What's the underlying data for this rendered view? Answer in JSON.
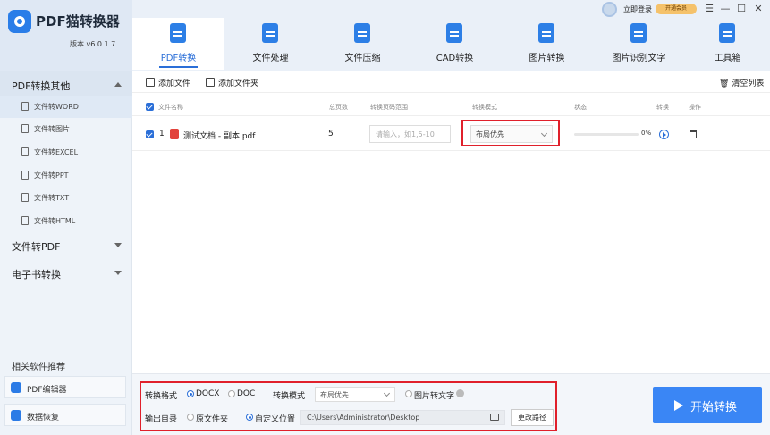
{
  "app": {
    "title": "PDF猫转换器",
    "version": "版本 v6.0.1.7"
  },
  "header": {
    "login": "立即登录",
    "vip": "开通会员",
    "menu_icon": "menu-icon",
    "minimize_icon": "minimize-icon",
    "maximize_icon": "maximize-icon",
    "close_icon": "close-icon"
  },
  "nav": {
    "tabs": [
      {
        "label": "PDF转换",
        "icon": "pdf-convert-icon",
        "active": true
      },
      {
        "label": "文件处理",
        "icon": "file-process-icon"
      },
      {
        "label": "文件压缩",
        "icon": "compress-icon"
      },
      {
        "label": "CAD转换",
        "icon": "cad-icon"
      },
      {
        "label": "图片转换",
        "icon": "image-convert-icon"
      },
      {
        "label": "图片识别文字",
        "icon": "ocr-icon"
      },
      {
        "label": "工具箱",
        "icon": "toolbox-icon"
      }
    ]
  },
  "sidebar": {
    "group_pdf": "PDF转换其他",
    "items": [
      {
        "label": "文件转WORD"
      },
      {
        "label": "文件转图片"
      },
      {
        "label": "文件转EXCEL"
      },
      {
        "label": "文件转PPT"
      },
      {
        "label": "文件转TXT"
      },
      {
        "label": "文件转HTML"
      }
    ],
    "group_to_pdf": "文件转PDF",
    "group_ebook": "电子书转换",
    "recommend_title": "相关软件推荐",
    "recommend": [
      {
        "label": "PDF编辑器"
      },
      {
        "label": "数据恢复"
      }
    ]
  },
  "toolbar": {
    "add_file": "添加文件",
    "add_folder": "添加文件夹",
    "clear_list": "清空列表"
  },
  "table": {
    "headers": {
      "name": "文件名称",
      "pages": "总页数",
      "range": "转换页码范围",
      "mode": "转换模式",
      "status": "状态",
      "convert": "转换",
      "action": "操作"
    },
    "rows": [
      {
        "index": "1",
        "name": "测试文档 - 副本.pdf",
        "pages": "5",
        "range_placeholder": "请输入，如1,5-10",
        "mode": "布局优先",
        "progress": 0,
        "progress_text": "0%"
      }
    ]
  },
  "bottom": {
    "format_label": "转换格式",
    "format_docx": "DOCX",
    "format_doc": "DOC",
    "mode_label": "转换模式",
    "mode_value": "布局优先",
    "image_to_text": "图片转文字",
    "output_label": "输出目录",
    "original_folder": "原文件夹",
    "custom_location": "自定义位置",
    "path": "C:\\Users\\Administrator\\Desktop",
    "change_path": "更改路径",
    "start": "开始转换"
  },
  "colors": {
    "accent": "#2b6fd8",
    "start_button": "#3a86f5",
    "highlight": "#e0202b"
  }
}
